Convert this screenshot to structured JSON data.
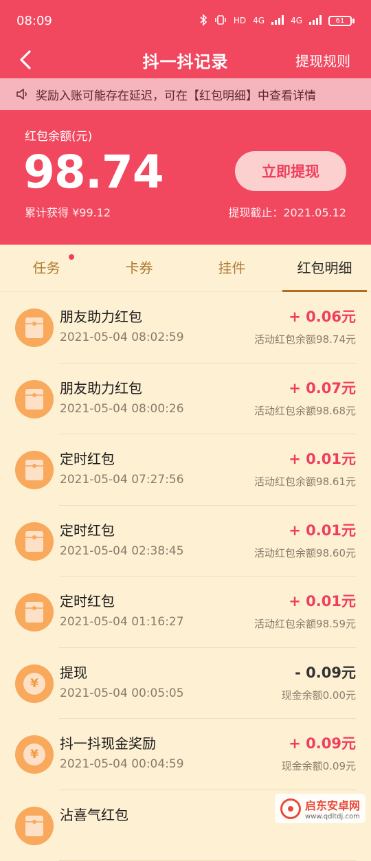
{
  "status_bar": {
    "time": "08:09",
    "signal1": "4G",
    "signal2": "4G",
    "hd": "HD",
    "battery": "61"
  },
  "nav": {
    "title": "抖一抖记录",
    "right": "提现规则"
  },
  "notice": {
    "text": "奖励入账可能存在延迟，可在【红包明细】中查看详情"
  },
  "balance": {
    "label": "红包余额(元)",
    "amount": "98.74",
    "total": "累计获得 ¥99.12",
    "button": "立即提现",
    "deadline": "提现截止：2021.05.12"
  },
  "tabs": [
    {
      "label": "任务"
    },
    {
      "label": "卡券"
    },
    {
      "label": "挂件"
    },
    {
      "label": "红包明细"
    }
  ],
  "records": [
    {
      "title": "朋友助力红包",
      "time": "2021-05-04 08:02:59",
      "amount": "+ 0.06元",
      "balance": "活动红包余额98.74元"
    },
    {
      "title": "朋友助力红包",
      "time": "2021-05-04 08:00:26",
      "amount": "+ 0.07元",
      "balance": "活动红包余额98.68元"
    },
    {
      "title": "定时红包",
      "time": "2021-05-04 07:27:56",
      "amount": "+ 0.01元",
      "balance": "活动红包余额98.61元"
    },
    {
      "title": "定时红包",
      "time": "2021-05-04 02:38:45",
      "amount": "+ 0.01元",
      "balance": "活动红包余额98.60元"
    },
    {
      "title": "定时红包",
      "time": "2021-05-04 01:16:27",
      "amount": "+ 0.01元",
      "balance": "活动红包余额98.59元"
    },
    {
      "title": "提现",
      "time": "2021-05-04 00:05:05",
      "amount": "- 0.09元",
      "balance": "现金余额0.00元"
    },
    {
      "title": "抖一抖现金奖励",
      "time": "2021-05-04 00:04:59",
      "amount": "+ 0.09元",
      "balance": "现金余额0.09元"
    },
    {
      "title": "沾喜气红包",
      "time": "",
      "amount": "",
      "balance": ""
    }
  ],
  "watermark": {
    "name": "启东安卓网",
    "url": "www.qdltdj.com"
  }
}
